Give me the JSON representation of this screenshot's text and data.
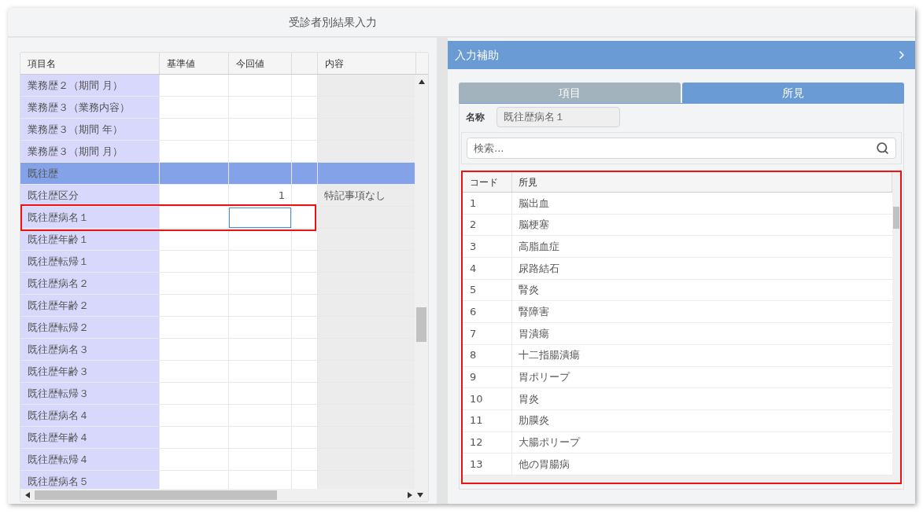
{
  "title": "受診者別結果入力",
  "grid": {
    "columns": [
      "項目名",
      "基準値",
      "今回値",
      "内容"
    ],
    "rows": [
      {
        "kind": "item",
        "name": "業務歴２（期間 月）"
      },
      {
        "kind": "item",
        "name": "業務歴３（業務内容）"
      },
      {
        "kind": "item",
        "name": "業務歴３（期間 年）"
      },
      {
        "kind": "item",
        "name": "業務歴３（期間 月）"
      },
      {
        "kind": "group",
        "name": "既往歴"
      },
      {
        "kind": "item",
        "name": "既往歴区分",
        "current": "1",
        "content": "特記事項なし"
      },
      {
        "kind": "input",
        "name": "既往歴病名１",
        "highlighted": true
      },
      {
        "kind": "item",
        "name": "既往歴年齢１"
      },
      {
        "kind": "item",
        "name": "既往歴転帰１"
      },
      {
        "kind": "item",
        "name": "既往歴病名２"
      },
      {
        "kind": "item",
        "name": "既往歴年齢２"
      },
      {
        "kind": "item",
        "name": "既往歴転帰２"
      },
      {
        "kind": "item",
        "name": "既往歴病名３"
      },
      {
        "kind": "item",
        "name": "既往歴年齢３"
      },
      {
        "kind": "item",
        "name": "既往歴転帰３"
      },
      {
        "kind": "item",
        "name": "既往歴病名４"
      },
      {
        "kind": "item",
        "name": "既往歴年齢４"
      },
      {
        "kind": "item",
        "name": "既往歴転帰４"
      },
      {
        "kind": "item",
        "name": "既往歴病名５"
      }
    ]
  },
  "assist": {
    "title": "入力補助",
    "tabs": [
      {
        "label": "項目",
        "selected": false
      },
      {
        "label": "所見",
        "selected": true
      }
    ],
    "name_label": "名称",
    "name_value": "既往歴病名１",
    "search": {
      "placeholder": "検索..."
    },
    "findings": {
      "highlighted": true,
      "columns": [
        "コード",
        "所見"
      ],
      "rows": [
        {
          "code": "1",
          "finding": "脳出血"
        },
        {
          "code": "2",
          "finding": "脳梗塞"
        },
        {
          "code": "3",
          "finding": "高脂血症"
        },
        {
          "code": "4",
          "finding": "尿路結石"
        },
        {
          "code": "5",
          "finding": "腎炎"
        },
        {
          "code": "6",
          "finding": "腎障害"
        },
        {
          "code": "7",
          "finding": "胃潰瘍"
        },
        {
          "code": "8",
          "finding": "十二指腸潰瘍"
        },
        {
          "code": "9",
          "finding": "胃ポリープ"
        },
        {
          "code": "10",
          "finding": "胃炎"
        },
        {
          "code": "11",
          "finding": "肋膜炎"
        },
        {
          "code": "12",
          "finding": "大腸ポリープ"
        },
        {
          "code": "13",
          "finding": "他の胃腸病"
        }
      ]
    }
  }
}
